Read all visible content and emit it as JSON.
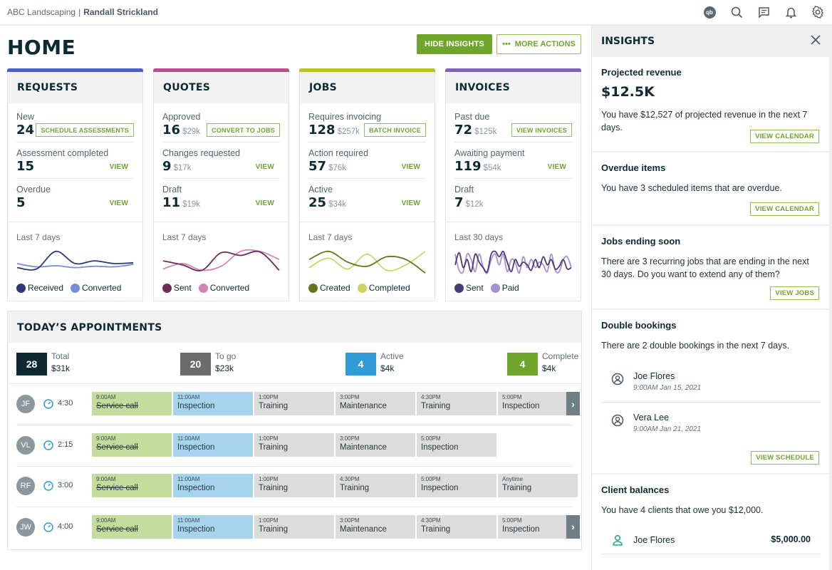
{
  "topbar": {
    "company": "ABC Landscaping",
    "separator": "|",
    "user": "Randall Strickland",
    "icons": [
      "quickbooks-icon",
      "search-icon",
      "messages-icon",
      "notifications-icon",
      "settings-icon"
    ],
    "qb_label": "qb"
  },
  "page": {
    "title": "HOME",
    "hide_insights": "HIDE INSIGHTS",
    "more_actions": "MORE ACTIONS",
    "more_actions_icon": "•••"
  },
  "colors": {
    "brand_green": "#6fa52b",
    "requests": "#4a5fc1",
    "quotes": "#b5508a",
    "jobs": "#b8c12f",
    "invoices": "#7e63b8",
    "appointment_total": "#0d2a33",
    "appointment_togo": "#6b6b6b",
    "appointment_active": "#2f9bd8",
    "appointment_complete": "#6fa52b"
  },
  "cards": [
    {
      "title": "REQUESTS",
      "accent": "#4a5fc1",
      "rows": [
        {
          "label": "New",
          "count": "24",
          "amount": "",
          "action": "SCHEDULE ASSESSMENTS",
          "action_type": "cta"
        },
        {
          "label": "Assessment completed",
          "count": "15",
          "amount": "",
          "action": "VIEW",
          "action_type": "link"
        },
        {
          "label": "Overdue",
          "count": "5",
          "amount": "",
          "action": "VIEW",
          "action_type": "link"
        }
      ],
      "chart_label": "Last 7 days",
      "legend": [
        {
          "name": "Received",
          "color": "#2c3878"
        },
        {
          "name": "Converted",
          "color": "#7b8ad8"
        }
      ]
    },
    {
      "title": "QUOTES",
      "accent": "#b5508a",
      "rows": [
        {
          "label": "Approved",
          "count": "16",
          "amount": "$29k",
          "action": "CONVERT TO JOBS",
          "action_type": "cta"
        },
        {
          "label": "Changes requested",
          "count": "9",
          "amount": "$17k",
          "action": "VIEW",
          "action_type": "link"
        },
        {
          "label": "Draft",
          "count": "11",
          "amount": "$19k",
          "action": "VIEW",
          "action_type": "link"
        }
      ],
      "chart_label": "Last 7 days",
      "legend": [
        {
          "name": "Sent",
          "color": "#6b2d55"
        },
        {
          "name": "Converted",
          "color": "#cf86b4"
        }
      ]
    },
    {
      "title": "JOBS",
      "accent": "#b8c12f",
      "rows": [
        {
          "label": "Requires invoicing",
          "count": "128",
          "amount": "$257k",
          "action": "BATCH INVOICE",
          "action_type": "cta"
        },
        {
          "label": "Action required",
          "count": "57",
          "amount": "$76k",
          "action": "VIEW",
          "action_type": "link"
        },
        {
          "label": "Active",
          "count": "25",
          "amount": "$34k",
          "action": "VIEW",
          "action_type": "link"
        }
      ],
      "chart_label": "Last 7 days",
      "legend": [
        {
          "name": "Created",
          "color": "#6b7320"
        },
        {
          "name": "Completed",
          "color": "#cdd465"
        }
      ]
    },
    {
      "title": "INVOICES",
      "accent": "#7e63b8",
      "rows": [
        {
          "label": "Past due",
          "count": "72",
          "amount": "$125k",
          "action": "VIEW INVOICES",
          "action_type": "cta"
        },
        {
          "label": "Awaiting payment",
          "count": "119",
          "amount": "$54k",
          "action": "VIEW",
          "action_type": "link"
        },
        {
          "label": "Draft",
          "count": "7",
          "amount": "$12k",
          "action": "",
          "action_type": "none"
        }
      ],
      "chart_label": "Last 30 days",
      "legend": [
        {
          "name": "Sent",
          "color": "#4b3878"
        },
        {
          "name": "Paid",
          "color": "#a68fd4"
        }
      ]
    }
  ],
  "chart_data": [
    {
      "type": "line",
      "title": "Requests — Last 7 days",
      "x": [
        1,
        2,
        3,
        4,
        5,
        6,
        7
      ],
      "series": [
        {
          "name": "Received",
          "values": [
            3,
            2.5,
            9,
            4.5,
            5.5,
            4.5,
            4.8
          ]
        },
        {
          "name": "Converted",
          "values": [
            4.5,
            3.3,
            3.7,
            3.0,
            3.5,
            3.3,
            4.2
          ]
        }
      ],
      "ylim": [
        0,
        10
      ]
    },
    {
      "type": "line",
      "title": "Quotes — Last 7 days",
      "x": [
        1,
        2,
        3,
        4,
        5,
        6,
        7
      ],
      "series": [
        {
          "name": "Sent",
          "values": [
            5.5,
            4,
            2,
            8.5,
            7.5,
            8.8,
            2
          ]
        },
        {
          "name": "Converted",
          "values": [
            2.5,
            4.5,
            2,
            3.5,
            9,
            9,
            6
          ]
        }
      ],
      "ylim": [
        0,
        10
      ]
    },
    {
      "type": "line",
      "title": "Jobs — Last 7 days",
      "x": [
        1,
        2,
        3,
        4,
        5,
        6,
        7
      ],
      "series": [
        {
          "name": "Created",
          "values": [
            6,
            9,
            5,
            3.5,
            7,
            6,
            1
          ]
        },
        {
          "name": "Completed",
          "values": [
            3,
            6.5,
            2.5,
            8,
            2,
            4,
            9
          ]
        }
      ],
      "ylim": [
        0,
        10
      ]
    },
    {
      "type": "line",
      "title": "Invoices — Last 30 days",
      "x": [
        1,
        2,
        3,
        4,
        5,
        6,
        7,
        8,
        9,
        10,
        11,
        12,
        13,
        14,
        15,
        16,
        17,
        18,
        19,
        20,
        21,
        22,
        23,
        24,
        25,
        26,
        27,
        28,
        29,
        30
      ],
      "series": [
        {
          "name": "Sent",
          "values": [
            4,
            8.5,
            3,
            6,
            1.5,
            8,
            5,
            3,
            1.5,
            8,
            9,
            7,
            9,
            5,
            1.5,
            6,
            3.5,
            5,
            4,
            2,
            6,
            3,
            7,
            4,
            6,
            2.5,
            3.5,
            6,
            2.5,
            3
          ]
        },
        {
          "name": "Paid",
          "values": [
            8,
            2,
            1.5,
            8,
            6,
            1.5,
            8,
            3,
            1,
            6,
            8,
            4,
            8,
            1.5,
            6,
            5,
            1,
            7,
            3,
            6,
            3,
            5,
            4,
            1.5,
            8,
            2,
            1.5,
            6,
            7,
            3
          ]
        }
      ],
      "ylim": [
        0,
        10
      ]
    }
  ],
  "appointments": {
    "title": "TODAY’S APPOINTMENTS",
    "stats": [
      {
        "count": "28",
        "label": "Total",
        "value": "$31k",
        "color": "#0d2a33"
      },
      {
        "count": "20",
        "label": "To go",
        "value": "$23k",
        "color": "#6b6b6b"
      },
      {
        "count": "4",
        "label": "Active",
        "value": "$4k",
        "color": "#2f9bd8"
      },
      {
        "count": "4",
        "label": "Complete",
        "value": "$4k",
        "color": "#6fa52b"
      }
    ],
    "rows": [
      {
        "initials": "JF",
        "duration": "4:30",
        "has_next": true,
        "slots": [
          {
            "time": "9:00AM",
            "name": "Service call",
            "status": "done"
          },
          {
            "time": "11:00AM",
            "name": "Inspection",
            "status": "active"
          },
          {
            "time": "1:00PM",
            "name": "Training",
            "status": "upcoming"
          },
          {
            "time": "3:00PM",
            "name": "Maintenance",
            "status": "upcoming"
          },
          {
            "time": "4:30PM",
            "name": "Training",
            "status": "upcoming"
          },
          {
            "time": "5:00PM",
            "name": "Inspection",
            "status": "upcoming"
          }
        ]
      },
      {
        "initials": "VL",
        "duration": "2:15",
        "has_next": false,
        "slots": [
          {
            "time": "9:00AM",
            "name": "Service call",
            "status": "done"
          },
          {
            "time": "11:00AM",
            "name": "Inspection",
            "status": "active"
          },
          {
            "time": "1:00PM",
            "name": "Training",
            "status": "upcoming"
          },
          {
            "time": "3:00PM",
            "name": "Maintenance",
            "status": "upcoming"
          },
          {
            "time": "5:00PM",
            "name": "Inspection",
            "status": "upcoming"
          }
        ]
      },
      {
        "initials": "RF",
        "duration": "3:00",
        "has_next": false,
        "slots": [
          {
            "time": "9:00AM",
            "name": "Service call",
            "status": "done"
          },
          {
            "time": "11:00AM",
            "name": "Inspection",
            "status": "active"
          },
          {
            "time": "1:00PM",
            "name": "Training",
            "status": "upcoming"
          },
          {
            "time": "4:30PM",
            "name": "Training",
            "status": "upcoming"
          },
          {
            "time": "5:00PM",
            "name": "Inspection",
            "status": "upcoming"
          },
          {
            "time": "Anytime",
            "name": "Training",
            "status": "upcoming"
          }
        ]
      },
      {
        "initials": "JW",
        "duration": "4:00",
        "has_next": true,
        "slots": [
          {
            "time": "9:00AM",
            "name": "Service call",
            "status": "done"
          },
          {
            "time": "11:00AM",
            "name": "Inspection",
            "status": "active"
          },
          {
            "time": "1:00PM",
            "name": "Training",
            "status": "upcoming"
          },
          {
            "time": "3:00PM",
            "name": "Maintenance",
            "status": "upcoming"
          },
          {
            "time": "4:30PM",
            "name": "Training",
            "status": "upcoming"
          },
          {
            "time": "5:00PM",
            "name": "Inspection",
            "status": "upcoming"
          }
        ]
      }
    ]
  },
  "insights": {
    "title": "INSIGHTS",
    "projected": {
      "title": "Projected revenue",
      "value": "$12.5K",
      "text": "You have $12,527 of projected revenue in the next 7 days.",
      "cta": "VIEW CALENDAR"
    },
    "overdue": {
      "title": "Overdue items",
      "text": "You have 3 scheduled items that are overdue.",
      "cta": "VIEW CALENDAR"
    },
    "jobs_ending": {
      "title": "Jobs ending soon",
      "text": "There are 3 recurring jobs that are ending in the next 30 days. Do you want to extend any of them?",
      "cta": "VIEW JOBS"
    },
    "double_bookings": {
      "title": "Double bookings",
      "text": "There are 2 double bookings in the next 7 days.",
      "people": [
        {
          "name": "Joe Flores",
          "datetime": "9:00AM Jan 15, 2021"
        },
        {
          "name": "Vera Lee",
          "datetime": "9:00AM Jan 21, 2021"
        }
      ],
      "cta": "VIEW SCHEDULE"
    },
    "client_balances": {
      "title": "Client balances",
      "text": "You have 4 clients that owe you $12,000.",
      "clients": [
        {
          "name": "Joe Flores",
          "amount": "$5,000.00"
        }
      ]
    }
  }
}
